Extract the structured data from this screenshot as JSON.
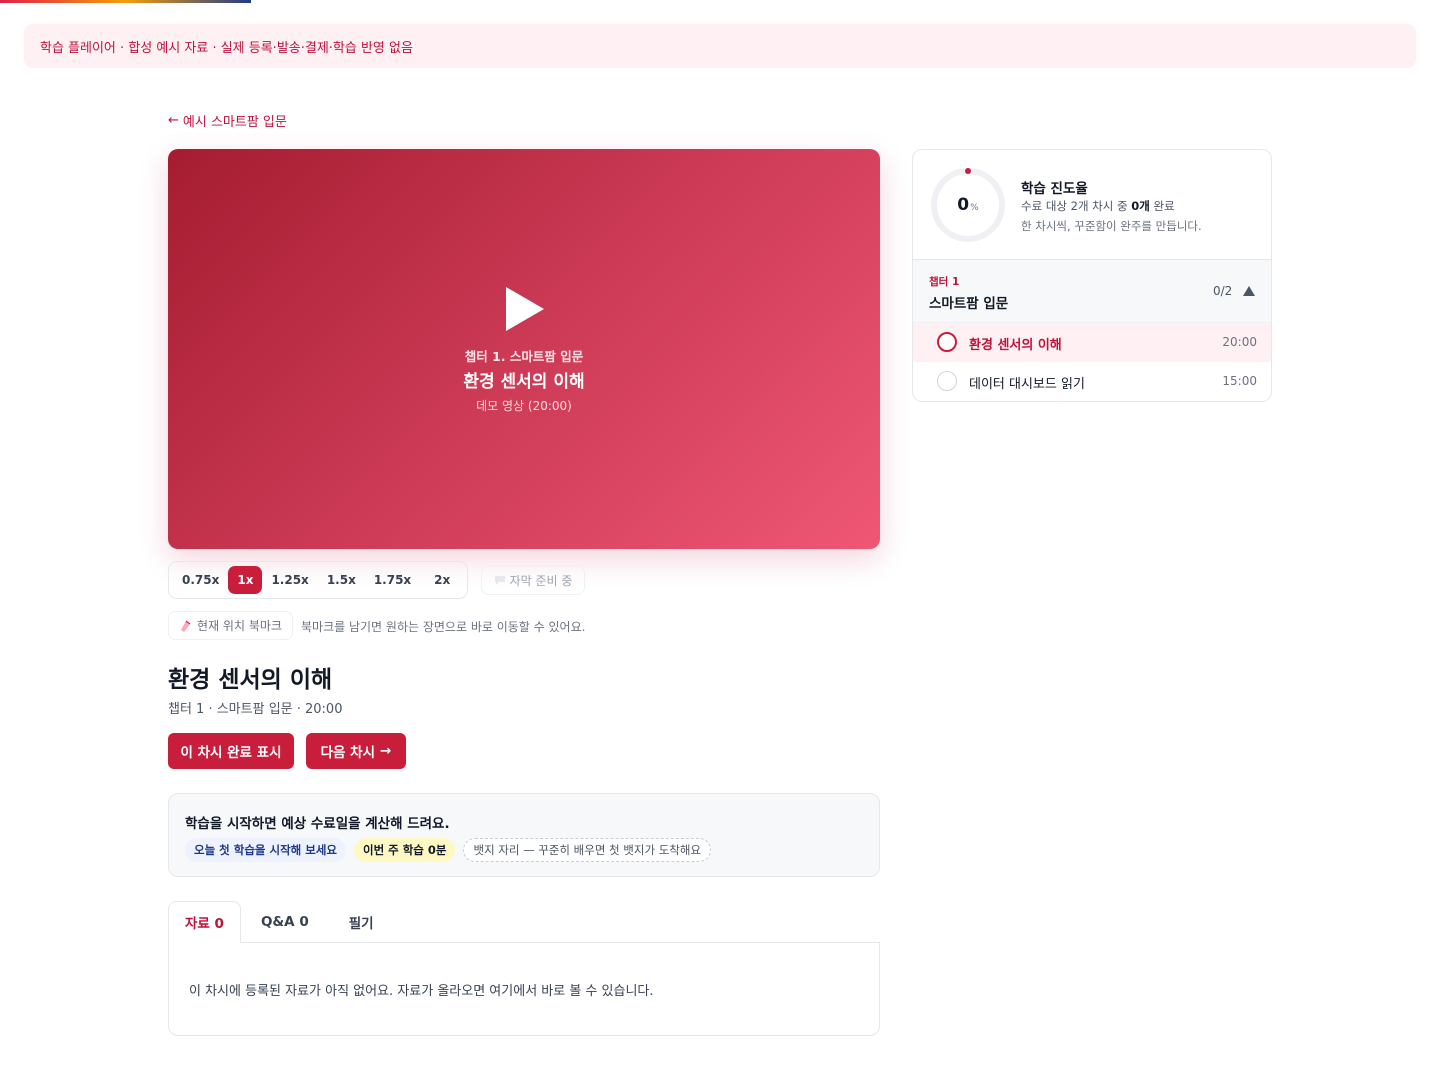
{
  "notice": {
    "text": "학습 플레이어 · 합성 예시 자료 · 실제 등록·발송·결제·학습 반영 없음"
  },
  "back_link": {
    "arrow": "←",
    "label": "예시 스마트팜 입문"
  },
  "player": {
    "chapter": "챕터 1. 스마트팜 입문",
    "title": "환경 센서의 이해",
    "subtitle": "데모 영상 (20:00)",
    "icon": "play-icon"
  },
  "speeds": [
    {
      "label": "0.75x",
      "active": false
    },
    {
      "label": "1x",
      "active": true
    },
    {
      "label": "1.25x",
      "active": false
    },
    {
      "label": "1.5x",
      "active": false
    },
    {
      "label": "1.75x",
      "active": false
    },
    {
      "label": "2x",
      "active": false
    }
  ],
  "subtitle_button": {
    "label": "자막 준비 중",
    "icon": "speech-bubble-icon"
  },
  "bookmark": {
    "label": "현재 위치 북마크",
    "icon": "bookmark-icon",
    "hint": "북마크를 남기면 원하는 장면으로 바로 이동할 수 있어요."
  },
  "lesson": {
    "title": "환경 센서의 이해",
    "meta": "챕터 1 · 스마트팜 입문 · 20:00",
    "complete_label": "이 차시 완료 표시",
    "next_label": "다음 차시",
    "next_arrow": "→"
  },
  "goal": {
    "title": "학습을 시작하면 예상 수료일을 계산해 드려요.",
    "chips": [
      "오늘 첫 학습을 시작해 보세요",
      "이번 주 학습 0분",
      "뱃지 자리 — 꾸준히 배우면 첫 뱃지가 도착해요"
    ]
  },
  "tabs": [
    {
      "label": "자료 0",
      "active": true
    },
    {
      "label": "Q&A 0",
      "active": false
    },
    {
      "label": "필기",
      "active": false
    }
  ],
  "tab_panel": {
    "empty_text": "이 차시에 등록된 자료가 아직 없어요. 자료가 올라오면 여기에서 바로 볼 수 있습니다."
  },
  "progress": {
    "percent": 0,
    "percent_num": "0",
    "percent_unit": "%",
    "title": "학습 진도율",
    "line_prefix": "수료 대상 2개 차시 중 ",
    "line_bold": "0개",
    "line_suffix": " 완료",
    "message": "한 차시씩, 꾸준함이 완주를 만듭니다."
  },
  "chapter": {
    "label": "챕터 1",
    "name": "스마트팜 입문",
    "count": "0/2",
    "caret_icon": "caret-up-icon",
    "lessons": [
      {
        "title": "환경 센서의 이해",
        "duration": "20:00",
        "current": true
      },
      {
        "title": "데이터 대시보드 읽기",
        "duration": "15:00",
        "current": false
      }
    ]
  },
  "colors": {
    "accent": "#c81e3c",
    "accent_text": "#be123c",
    "notice_bg": "#fff1f3"
  }
}
